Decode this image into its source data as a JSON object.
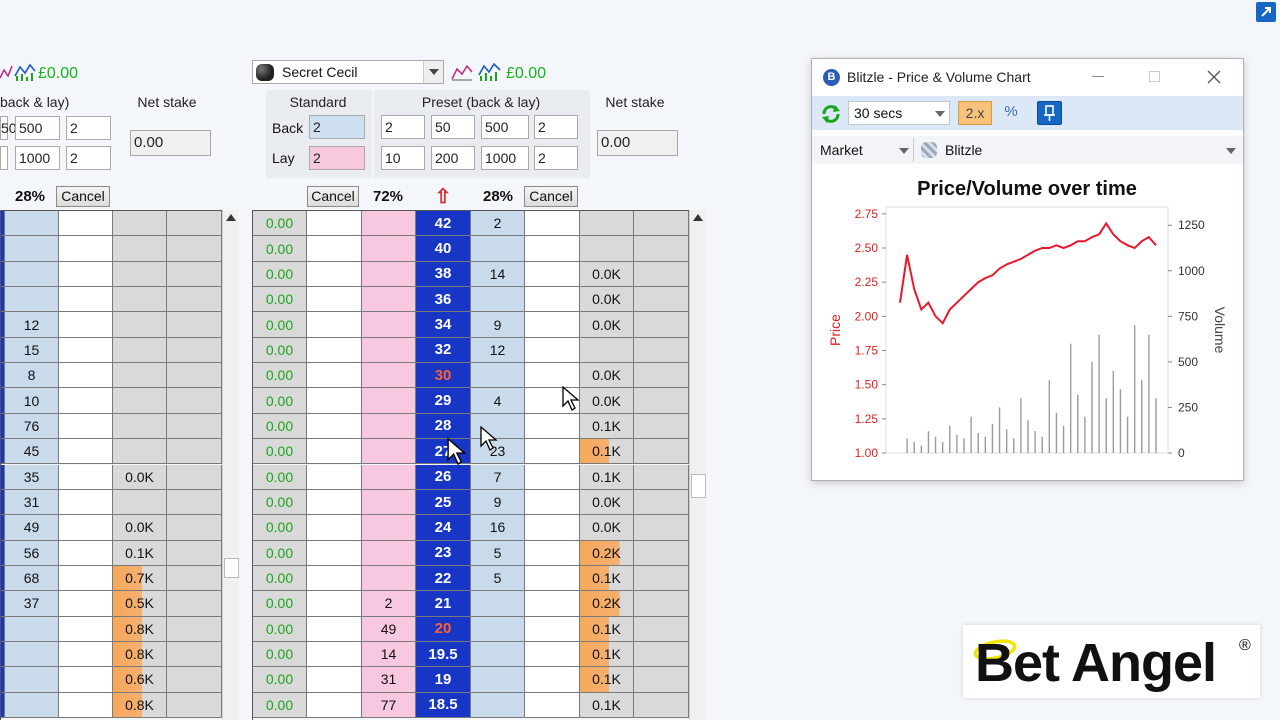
{
  "left_panel": {
    "pnl": "£0.00",
    "preset_header": "back & lay)",
    "net_stake_header": "Net stake",
    "preset_back": [
      "500",
      "2"
    ],
    "preset_lay": [
      "1000",
      "2"
    ],
    "net_stake_value": "0.00",
    "back_pct": "28%",
    "cancel_label": "Cancel",
    "rows": [
      {
        "a": "",
        "b": ""
      },
      {
        "a": "",
        "b": ""
      },
      {
        "a": "",
        "b": ""
      },
      {
        "a": "",
        "b": ""
      },
      {
        "a": "12",
        "b": ""
      },
      {
        "a": "15",
        "b": ""
      },
      {
        "a": "8",
        "b": ""
      },
      {
        "a": "10",
        "b": ""
      },
      {
        "a": "76",
        "b": ""
      },
      {
        "a": "45",
        "b": ""
      },
      {
        "a": "35",
        "b": "0.0K"
      },
      {
        "a": "31",
        "b": ""
      },
      {
        "a": "49",
        "b": "0.0K"
      },
      {
        "a": "56",
        "b": "0.1K"
      },
      {
        "a": "68",
        "b": "0.7K"
      },
      {
        "a": "37",
        "b": "0.5K"
      },
      {
        "a": "",
        "b": "0.8K"
      },
      {
        "a": "",
        "b": "0.8K"
      },
      {
        "a": "",
        "b": "0.6K"
      },
      {
        "a": "",
        "b": "0.8K"
      }
    ]
  },
  "main_panel": {
    "selection_name": "Secret Cecil",
    "pnl": "£0.00",
    "standard_header": "Standard",
    "preset_header": "Preset (back & lay)",
    "net_stake_header": "Net stake",
    "back_label": "Back",
    "lay_label": "Lay",
    "standard_back": "2",
    "standard_lay": "2",
    "preset_back": [
      "2",
      "50",
      "500",
      "2"
    ],
    "preset_lay": [
      "10",
      "200",
      "1000",
      "2"
    ],
    "net_stake_value": "0.00",
    "cancel_left": "Cancel",
    "lay_pct": "72%",
    "up_arrow": "⇧",
    "back_pct": "28%",
    "cancel_right": "Cancel",
    "rows": [
      {
        "pl": "0.00",
        "lay": "",
        "price": "42",
        "back": "2",
        "vol": ""
      },
      {
        "pl": "0.00",
        "lay": "",
        "price": "40",
        "back": "",
        "vol": ""
      },
      {
        "pl": "0.00",
        "lay": "",
        "price": "38",
        "back": "14",
        "vol": "0.0K"
      },
      {
        "pl": "0.00",
        "lay": "",
        "price": "36",
        "back": "",
        "vol": "0.0K"
      },
      {
        "pl": "0.00",
        "lay": "",
        "price": "34",
        "back": "9",
        "vol": "0.0K"
      },
      {
        "pl": "0.00",
        "lay": "",
        "price": "32",
        "back": "12",
        "vol": ""
      },
      {
        "pl": "0.00",
        "lay": "",
        "price": "30",
        "back": "",
        "vol": "0.0K"
      },
      {
        "pl": "0.00",
        "lay": "",
        "price": "29",
        "back": "4",
        "vol": "0.0K"
      },
      {
        "pl": "0.00",
        "lay": "",
        "price": "28",
        "back": "",
        "vol": "0.1K"
      },
      {
        "pl": "0.00",
        "lay": "",
        "price": "27",
        "back": "23",
        "vol": "0.1K"
      },
      {
        "pl": "0.00",
        "lay": "",
        "price": "26",
        "back": "7",
        "vol": "0.1K"
      },
      {
        "pl": "0.00",
        "lay": "",
        "price": "25",
        "back": "9",
        "vol": "0.0K"
      },
      {
        "pl": "0.00",
        "lay": "",
        "price": "24",
        "back": "16",
        "vol": "0.0K"
      },
      {
        "pl": "0.00",
        "lay": "",
        "price": "23",
        "back": "5",
        "vol": "0.2K"
      },
      {
        "pl": "0.00",
        "lay": "",
        "price": "22",
        "back": "5",
        "vol": "0.1K"
      },
      {
        "pl": "0.00",
        "lay": "2",
        "price": "21",
        "back": "",
        "vol": "0.2K"
      },
      {
        "pl": "0.00",
        "lay": "49",
        "price": "20",
        "back": "",
        "vol": "0.1K"
      },
      {
        "pl": "0.00",
        "lay": "14",
        "price": "19.5",
        "back": "",
        "vol": "0.1K"
      },
      {
        "pl": "0.00",
        "lay": "31",
        "price": "19",
        "back": "",
        "vol": "0.1K"
      },
      {
        "pl": "0.00",
        "lay": "77",
        "price": "18.5",
        "back": "",
        "vol": "0.1K"
      }
    ]
  },
  "chart_window": {
    "title": "Blitzle - Price & Volume Chart",
    "interval": "30 secs",
    "scale_btn": "2.x",
    "pct_btn": "%",
    "market_label": "Market",
    "selection": "Blitzle",
    "chart_title": "Price/Volume over time",
    "ylabel_left": "Price",
    "ylabel_right": "Volume",
    "price_ticks": [
      "2.75",
      "2.50",
      "2.25",
      "2.00",
      "1.75",
      "1.50",
      "1.25",
      "1.00"
    ],
    "volume_ticks": [
      "1250",
      "1000",
      "750",
      "500",
      "250",
      "0"
    ]
  },
  "chart_data": {
    "type": "line",
    "title": "Price/Volume over time",
    "ylabel": "Price",
    "y2label": "Volume",
    "ylim": [
      1.0,
      2.8
    ],
    "y2lim": [
      0,
      1350
    ],
    "series": [
      {
        "name": "Price",
        "values": [
          2.1,
          2.45,
          2.2,
          2.05,
          2.1,
          2.0,
          1.95,
          2.05,
          2.1,
          2.15,
          2.2,
          2.25,
          2.28,
          2.3,
          2.35,
          2.38,
          2.4,
          2.42,
          2.45,
          2.48,
          2.5,
          2.5,
          2.52,
          2.5,
          2.52,
          2.55,
          2.55,
          2.58,
          2.6,
          2.68,
          2.6,
          2.55,
          2.52,
          2.5,
          2.55,
          2.58,
          2.52
        ]
      },
      {
        "name": "Volume",
        "values": [
          0,
          80,
          60,
          40,
          120,
          90,
          60,
          150,
          100,
          80,
          200,
          110,
          90,
          160,
          250,
          130,
          80,
          300,
          180,
          120,
          90,
          400,
          220,
          150,
          600,
          320,
          200,
          500,
          650,
          300,
          450,
          350,
          200,
          700,
          400,
          650,
          300
        ]
      }
    ],
    "price_color": "#e8182d",
    "volume_color": "#9a9a9a"
  },
  "brand": {
    "name": "Bet Angel",
    "reg": "®"
  }
}
